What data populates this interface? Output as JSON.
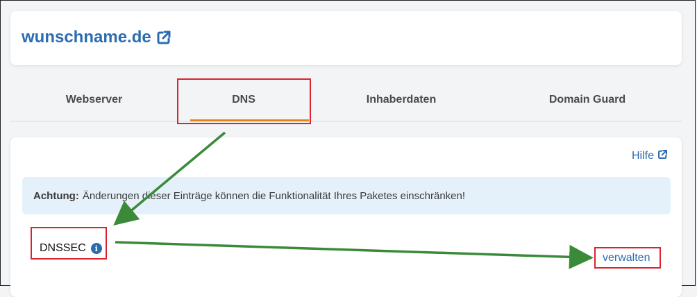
{
  "domain": {
    "name": "wunschname.de",
    "link_icon": "external-link-icon"
  },
  "tabs": [
    {
      "label": "Webserver",
      "active": false
    },
    {
      "label": "DNS",
      "active": true
    },
    {
      "label": "Inhaberdaten",
      "active": false
    },
    {
      "label": "Domain Guard",
      "active": false
    }
  ],
  "help": {
    "label": "Hilfe",
    "icon": "external-link-icon"
  },
  "alert": {
    "prefix": "Achtung:",
    "text": "Änderungen dieser Einträge können die Funktionalität Ihres Paketes einschränken!"
  },
  "dnssec": {
    "label": "DNSSEC",
    "info_icon": "info-icon",
    "manage_label": "verwalten"
  },
  "colors": {
    "accent_blue": "#2b6cb0",
    "active_tab_underline": "#e8831c",
    "highlight_red": "#d9232d",
    "arrow_green": "#3a8a3a",
    "alert_bg": "#e5f1fa"
  }
}
